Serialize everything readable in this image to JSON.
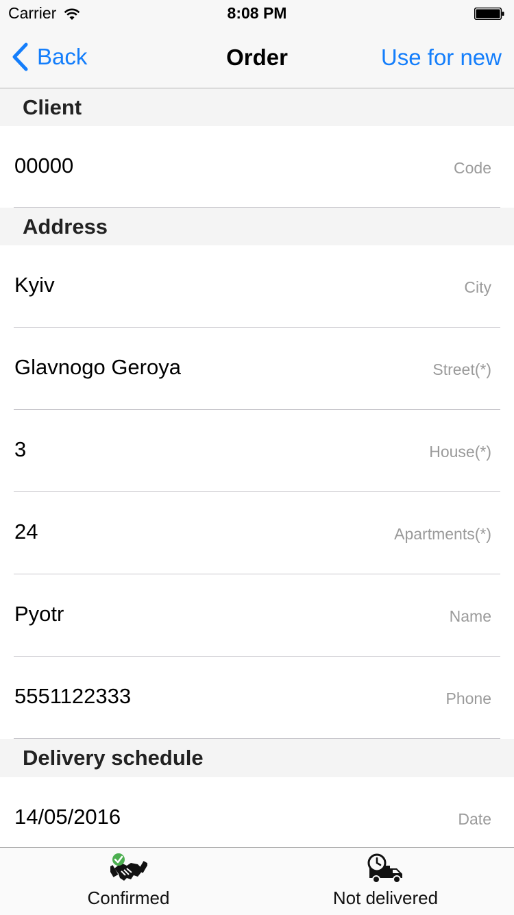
{
  "status_bar": {
    "carrier": "Carrier",
    "time": "8:08 PM"
  },
  "nav": {
    "back_label": "Back",
    "title": "Order",
    "right_label": "Use for new"
  },
  "sections": {
    "client": {
      "header": "Client",
      "code": {
        "value": "00000",
        "label": "Code"
      }
    },
    "address": {
      "header": "Address",
      "city": {
        "value": "Kyiv",
        "label": "City"
      },
      "street": {
        "value": "Glavnogo Geroya",
        "label": "Street(*)"
      },
      "house": {
        "value": "3",
        "label": "House(*)"
      },
      "apartments": {
        "value": "24",
        "label": "Apartments(*)"
      },
      "name": {
        "value": "Pyotr",
        "label": "Name"
      },
      "phone": {
        "value": "5551122333",
        "label": "Phone"
      }
    },
    "delivery": {
      "header": "Delivery schedule",
      "date": {
        "value": "14/05/2016",
        "label": "Date"
      }
    }
  },
  "tab_bar": {
    "confirmed": {
      "label": "Confirmed",
      "icon": "handshake-check-icon"
    },
    "not_delivered": {
      "label": "Not delivered",
      "icon": "delivery-truck-clock-icon"
    }
  },
  "colors": {
    "accent": "#147efb",
    "check": "#4caf50"
  }
}
